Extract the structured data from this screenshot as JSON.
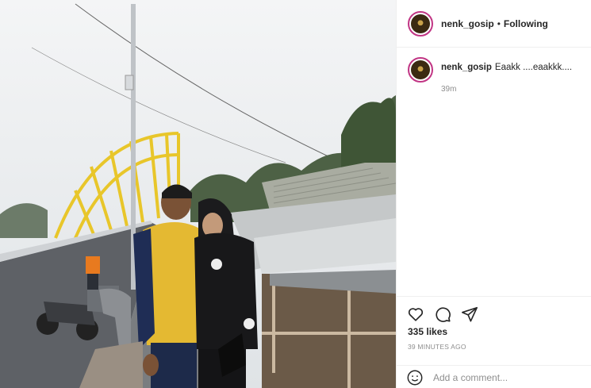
{
  "header": {
    "username": "nenk_gosip",
    "separator": "•",
    "follow_status": "Following"
  },
  "caption": {
    "username": "nenk_gosip",
    "text": "Eaakk ....eaakkk....",
    "time": "39m"
  },
  "actions": {
    "icons": [
      "heart-icon",
      "comment-icon",
      "share-icon"
    ],
    "likes": "335 likes",
    "timestamp": "39 MINUTES AGO"
  },
  "comment": {
    "placeholder": "Add a comment...",
    "emoji_icon": "smiley-icon"
  },
  "colors": {
    "avatar_ring": "#c13584",
    "muted_text": "#8e8e8e",
    "bridge": "#e8c62a"
  }
}
